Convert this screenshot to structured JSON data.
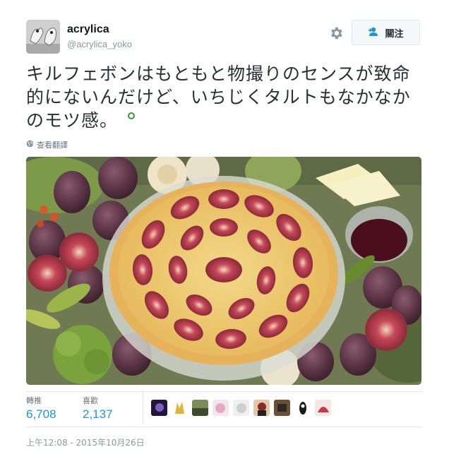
{
  "user": {
    "display_name": "acrylica",
    "handle": "@acrylica_yoko"
  },
  "follow_button": {
    "label": "關注"
  },
  "tweet": {
    "lines": [
      "キルフェボンはもともと物撮りのセンスが致命",
      "的にないんだけど、いちじくタルトもなかなか",
      "のモツ感。"
    ]
  },
  "translate_label": "查看翻譯",
  "stats": {
    "retweets_label": "轉推",
    "retweets_count": "6,708",
    "likes_label": "喜歡",
    "likes_count": "2,137"
  },
  "timestamp": "上午12:08 - 2015年10月26日",
  "colors": {
    "accent": "#1b95e0",
    "text": "#292f33",
    "muted": "#8899a6"
  }
}
